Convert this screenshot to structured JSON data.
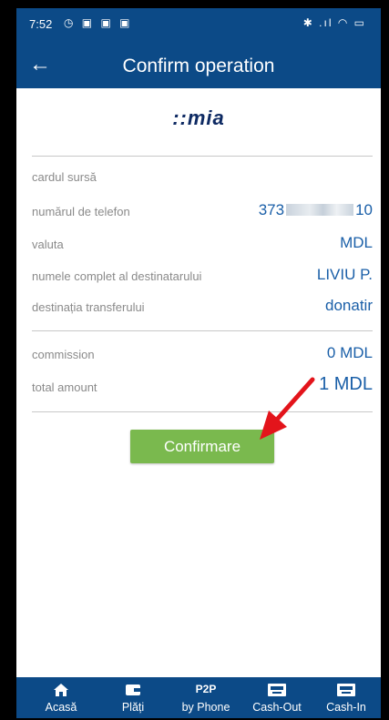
{
  "status_bar": {
    "time": "7:52",
    "left_icons": [
      "alarm-icon",
      "nfc-icon",
      "app-icon",
      "app-icon"
    ],
    "right_icons": [
      "bluetooth-icon",
      "signal-icon",
      "wifi-icon",
      "battery-icon"
    ],
    "left_glyphs": "◷ ▣ ▣ ▣",
    "right_glyphs": "✱ .ıl ◠ ▭"
  },
  "header": {
    "title": "Confirm operation",
    "back_icon": "arrow-left-icon"
  },
  "logo_text": "::mia",
  "details": {
    "source_card_label": "cardul sursă",
    "phone_label": "numărul de telefon",
    "phone_prefix": "373",
    "phone_suffix": "10",
    "currency_label": "valuta",
    "currency_value": "MDL",
    "recipient_label": "numele complet al destinatarului",
    "recipient_value": "LIVIU P.",
    "purpose_label": "destinația transferului",
    "purpose_value": "donatir",
    "commission_label": "commission",
    "commission_value": "0 MDL",
    "total_label": "total amount",
    "total_value": "1 MDL"
  },
  "confirm_button": "Confirmare",
  "annotation_arrow_color": "#e3141b",
  "bottom_nav": [
    {
      "label": "Acasă",
      "icon": "home-icon"
    },
    {
      "label": "Plăți",
      "icon": "wallet-icon"
    },
    {
      "label": "by Phone",
      "icon": "p2p-icon",
      "icon_text": "P2P"
    },
    {
      "label": "Cash-Out",
      "icon": "cash-out-icon"
    },
    {
      "label": "Cash-In",
      "icon": "cash-in-icon"
    }
  ],
  "colors": {
    "header_blue": "#0c4a87",
    "value_blue": "#1a5fa8",
    "button_green": "#7ab94e"
  }
}
